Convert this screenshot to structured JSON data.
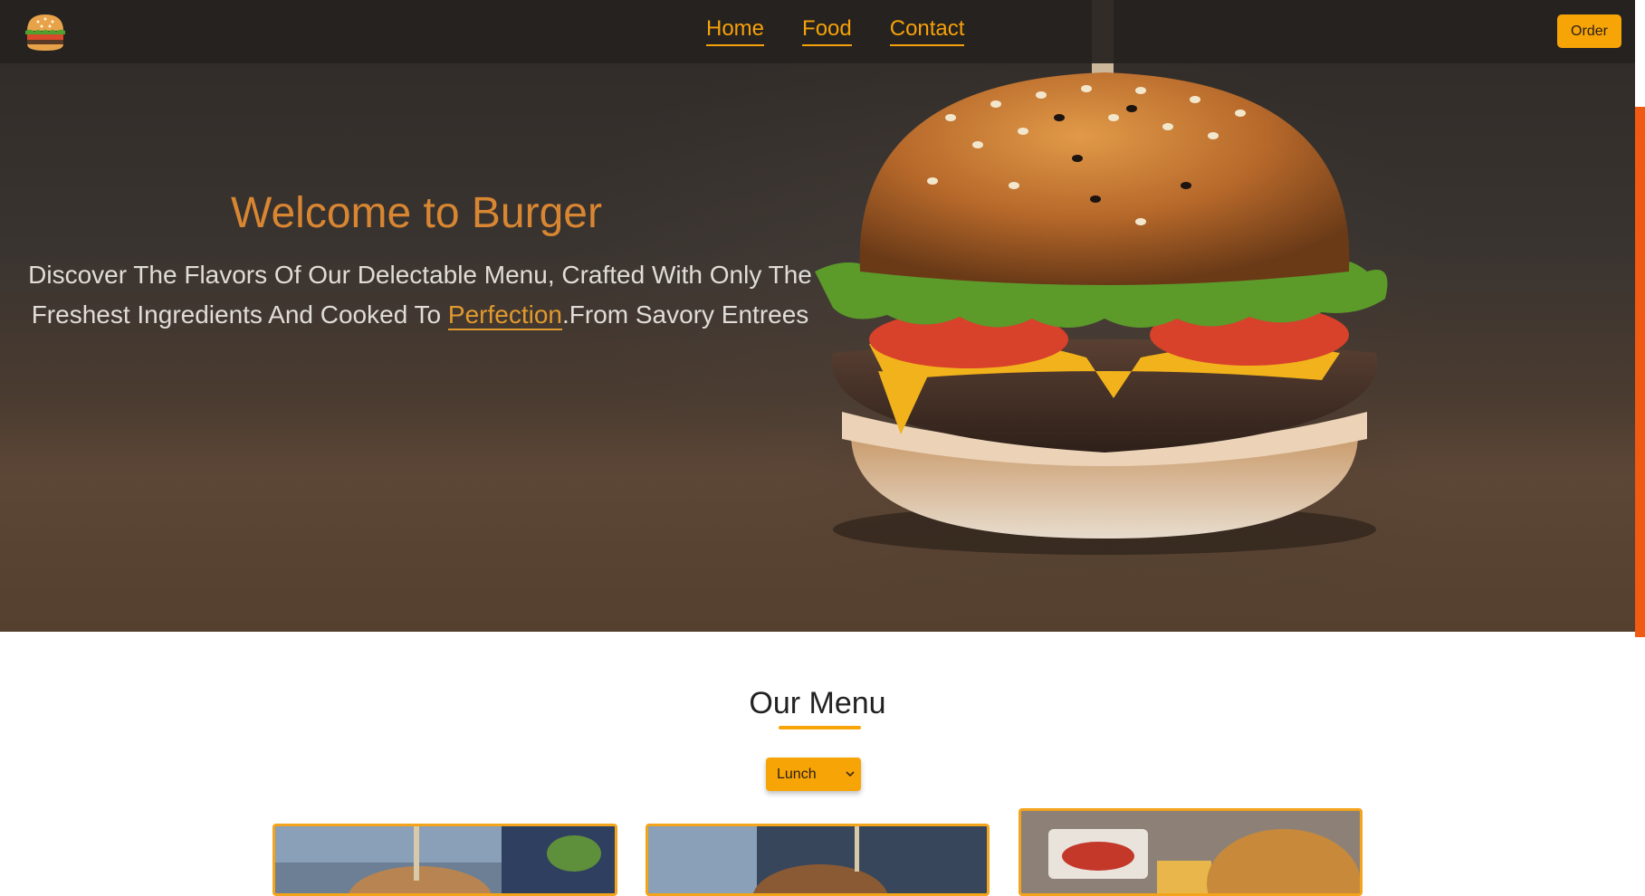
{
  "navbar": {
    "logo": "burger-logo",
    "links": [
      {
        "label": "Home"
      },
      {
        "label": "Food"
      },
      {
        "label": "Contact"
      }
    ],
    "order_button": "Order"
  },
  "hero": {
    "title": "Welcome to Burger",
    "description_part1": "Discover The Flavors Of Our Delectable Menu, Crafted With Only The Freshest Ingredients And Cooked To ",
    "highlight": "Perfection",
    "description_part2": ".From Savory Entrees",
    "background_image": "burger-photo"
  },
  "menu": {
    "title": "Our Menu",
    "category_select": {
      "selected": "Lunch"
    },
    "cards": [
      {
        "image": "burger-photo-1"
      },
      {
        "image": "burger-photo-2"
      },
      {
        "image": "burger-fries-photo-3"
      }
    ]
  },
  "colors": {
    "accent": "#f7a407",
    "title": "#d88632",
    "scroll_strip": "#f05a13"
  }
}
